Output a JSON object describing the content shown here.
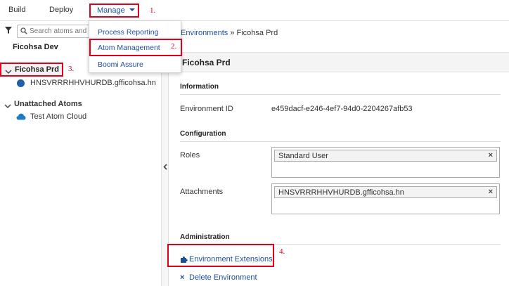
{
  "nav": {
    "build": "Build",
    "deploy": "Deploy",
    "manage": "Manage"
  },
  "manage_menu": {
    "items": [
      "Process Reporting",
      "Atom Management",
      "Boomi Assure"
    ]
  },
  "annotations": {
    "step1": "1.",
    "step2": "2.",
    "step3": "3.",
    "step4": "4."
  },
  "left": {
    "search_placeholder": "Search atoms and environments",
    "environment_dev": "Ficohsa Dev",
    "environment_prd": "Ficohsa Prd",
    "atom_name": "HNSVRRRHHVHURDB.gfficohsa.hn",
    "unattached_title": "Unattached Atoms",
    "cloud_name": "Test Atom Cloud"
  },
  "breadcrumb": {
    "link": "Environments",
    "separator": " » ",
    "current": "Ficohsa Prd"
  },
  "detail": {
    "title": "Ficohsa Prd",
    "information_title": "Information",
    "env_id_label": "Environment ID",
    "env_id_value": "e459dacf-e246-4ef7-94d0-2204267afb53",
    "configuration_title": "Configuration",
    "roles_label": "Roles",
    "roles_value": "Standard User",
    "attachments_label": "Attachments",
    "attachments_value": "HNSVRRRHHVHURDB.gfficohsa.hn",
    "administration_title": "Administration",
    "env_extensions": "Environment Extensions",
    "delete_env": "Delete Environment",
    "remove_symbol": "×"
  },
  "colors": {
    "link": "#1f4e9a",
    "annotation": "#e0001b",
    "atom_online": "#1f5ea8",
    "cloud": "#1f7ac8"
  }
}
